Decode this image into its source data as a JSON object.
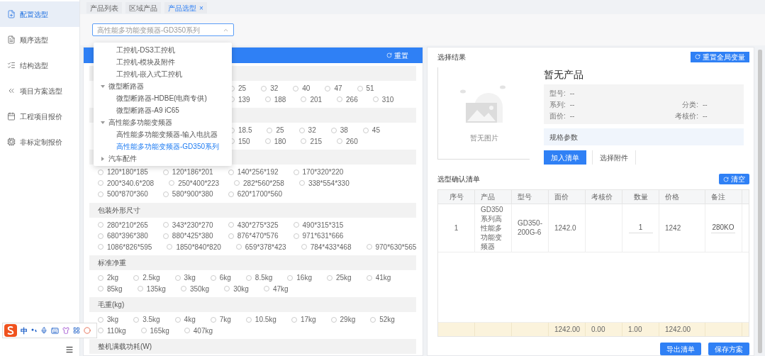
{
  "sidebar": {
    "items": [
      {
        "label": "配置选型",
        "selected": true
      },
      {
        "label": "顺序选型",
        "selected": false
      },
      {
        "label": "结构选型",
        "selected": false
      },
      {
        "label": "项目方案选型",
        "selected": false
      },
      {
        "label": "工程项目报价",
        "selected": false
      },
      {
        "label": "非标定制报价",
        "selected": false
      }
    ]
  },
  "tags": [
    {
      "label": "产品列表",
      "selected": false
    },
    {
      "label": "区域产品",
      "selected": false
    },
    {
      "label": "产品选型",
      "selected": true,
      "close": "×"
    }
  ],
  "select": {
    "value": "高性能多功能变频器-GD350系列",
    "open": true,
    "tree": [
      {
        "children": [
          {
            "label": "工控机-DS3工控机",
            "selected": false
          },
          {
            "label": "工控机-模块及附件",
            "selected": false
          },
          {
            "label": "工控机-嵌入式工控机",
            "selected": false
          }
        ]
      },
      {
        "label": "微型断路器",
        "expanded": true,
        "children": [
          {
            "label": "微型断路器-HDBE(电商专供)",
            "selected": false
          },
          {
            "label": "微型断路器-A9 iC65",
            "selected": false
          }
        ]
      },
      {
        "label": "高性能多功能变频器",
        "expanded": true,
        "children": [
          {
            "label": "高性能多功能变频器-输入电抗器",
            "selected": false
          },
          {
            "label": "高性能多功能变频器-GD350系列",
            "selected": true
          }
        ]
      },
      {
        "label": "汽车配件",
        "expanded": false
      }
    ]
  },
  "filter_panel": {
    "reset": "重置",
    "sections": [
      {
        "rows": [
          [
            {
              "label": "25",
              "selected": false
            },
            {
              "label": "32",
              "selected": false
            },
            {
              "label": "40",
              "selected": false
            },
            {
              "label": "47",
              "selected": false
            },
            {
              "label": "51",
              "selected": false
            }
          ],
          [
            {
              "label": "139",
              "selected": false
            },
            {
              "label": "188",
              "selected": false
            },
            {
              "label": "201",
              "selected": false
            },
            {
              "label": "266",
              "selected": false
            },
            {
              "label": "310",
              "selected": false
            }
          ]
        ]
      },
      {
        "rows": [
          [
            {
              "label": "18.5",
              "selected": false
            },
            {
              "label": "25",
              "selected": false
            },
            {
              "label": "32",
              "selected": false
            },
            {
              "label": "38",
              "selected": false
            },
            {
              "label": "45",
              "selected": false
            }
          ],
          [
            {
              "label": "150",
              "selected": false
            },
            {
              "label": "180",
              "selected": false
            },
            {
              "label": "215",
              "selected": false
            },
            {
              "label": "260",
              "selected": false
            }
          ]
        ]
      },
      {
        "rows": [
          [
            {
              "label": "120*180*185",
              "selected": false
            },
            {
              "label": "120*186*201",
              "selected": false
            },
            {
              "label": "140*256*192",
              "selected": false
            },
            {
              "label": "170*320*220",
              "selected": false
            }
          ],
          [
            {
              "label": "200*340.6*208",
              "selected": false
            },
            {
              "label": "250*400*223",
              "selected": false
            },
            {
              "label": "282*560*258",
              "selected": false
            },
            {
              "label": "338*554*330",
              "selected": false
            }
          ],
          [
            {
              "label": "500*870*360",
              "selected": false
            },
            {
              "label": "580*900*380",
              "selected": false
            },
            {
              "label": "620*1700*560",
              "selected": false
            }
          ]
        ]
      },
      {
        "title": "包装外形尺寸",
        "rows": [
          [
            {
              "label": "280*210*265",
              "selected": false
            },
            {
              "label": "343*230*270",
              "selected": false
            },
            {
              "label": "430*275*325",
              "selected": false
            },
            {
              "label": "490*315*315",
              "selected": false
            }
          ],
          [
            {
              "label": "680*396*380",
              "selected": false
            },
            {
              "label": "880*425*380",
              "selected": false
            },
            {
              "label": "876*470*576",
              "selected": false
            },
            {
              "label": "971*631*666",
              "selected": false
            }
          ],
          [
            {
              "label": "1086*826*595",
              "selected": false
            },
            {
              "label": "1850*840*820",
              "selected": false
            },
            {
              "label": "659*378*423",
              "selected": false
            },
            {
              "label": "784*433*468",
              "selected": false
            },
            {
              "label": "970*630*565",
              "selected": false
            }
          ]
        ]
      },
      {
        "title": "标准净重",
        "rows": [
          [
            {
              "label": "2kg",
              "selected": false
            },
            {
              "label": "2.5kg",
              "selected": false
            },
            {
              "label": "3kg",
              "selected": false
            },
            {
              "label": "6kg",
              "selected": false
            },
            {
              "label": "8.5kg",
              "selected": false
            },
            {
              "label": "16kg",
              "selected": false
            },
            {
              "label": "25kg",
              "selected": false
            },
            {
              "label": "41kg",
              "selected": false
            }
          ],
          [
            {
              "label": "85kg",
              "selected": false
            },
            {
              "label": "135kg",
              "selected": false
            },
            {
              "label": "350kg",
              "selected": false
            },
            {
              "label": "30kg",
              "selected": false
            },
            {
              "label": "47kg",
              "selected": false
            }
          ]
        ]
      },
      {
        "title": "毛重(kg)",
        "rows": [
          [
            {
              "label": "3kg",
              "selected": false
            },
            {
              "label": "3.5kg",
              "selected": false
            },
            {
              "label": "4kg",
              "selected": false
            },
            {
              "label": "7kg",
              "selected": false
            },
            {
              "label": "10.5kg",
              "selected": false
            },
            {
              "label": "17kg",
              "selected": false
            },
            {
              "label": "29kg",
              "selected": false
            },
            {
              "label": "52kg",
              "selected": false
            }
          ],
          [
            {
              "label": "110kg",
              "selected": false
            },
            {
              "label": "165kg",
              "selected": false
            },
            {
              "label": "407kg",
              "selected": false
            }
          ]
        ]
      },
      {
        "title": "整机满载功耗(W)"
      }
    ]
  },
  "result": {
    "title": "选择结果",
    "reset_button": "重置全局变量",
    "image_caption": "暂无图片",
    "product_name": "暂无产品",
    "fields": [
      [
        {
          "label": "型号:",
          "value": "--"
        }
      ],
      [
        {
          "label": "系列:",
          "value": "--"
        },
        {
          "label": "分类:",
          "value": "--"
        }
      ],
      [
        {
          "label": "面价:",
          "value": "--"
        },
        {
          "label": "考核价:",
          "value": "--"
        }
      ]
    ],
    "spec_label": "规格参数",
    "buttons": [
      {
        "label": "加入清单",
        "kind": "primary"
      },
      {
        "label": "选择附件",
        "kind": "default"
      }
    ]
  },
  "cart": {
    "title": "选型确认清单",
    "clear_button": "清空",
    "columns": [
      "序号",
      "产品",
      "型号",
      "面价",
      "考核价",
      "数量",
      "价格",
      "备注"
    ],
    "rows": [
      [
        {
          "kind": "text",
          "text": "1"
        },
        {
          "kind": "text",
          "text": "GD350系列高性能多功能变频器"
        },
        {
          "kind": "text",
          "text": "GD350-200G-6"
        },
        {
          "kind": "text",
          "text": "1242.0"
        },
        {
          "kind": "text"
        },
        {
          "kind": "input",
          "text": "1"
        },
        {
          "kind": "text",
          "text": "1242"
        },
        {
          "kind": "input",
          "text": "280KO"
        }
      ]
    ],
    "summary": {
      "face_price": "1242.00",
      "check_price": "0.00",
      "quantity": "1.00",
      "price": "1242.00"
    },
    "buttons": [
      "导出清单",
      "保存方案"
    ]
  },
  "ime_toolbar": {
    "mode": "中"
  }
}
